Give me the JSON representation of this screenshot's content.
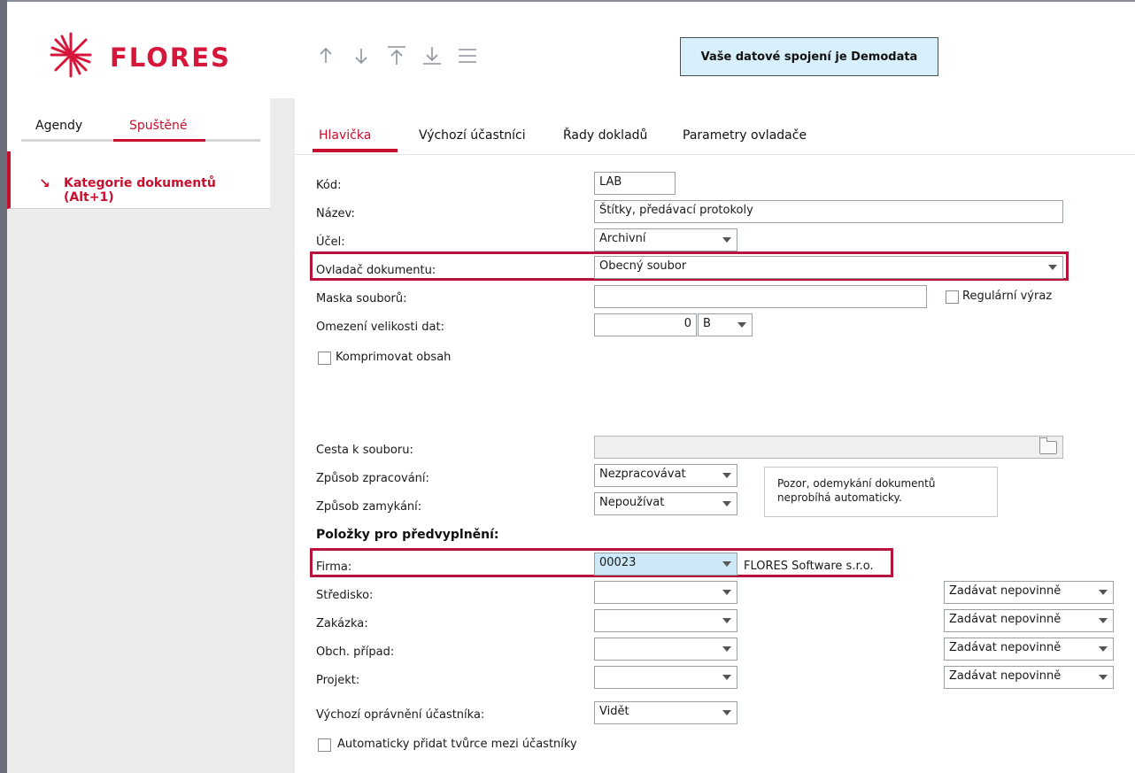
{
  "header": {
    "logo_text": "FLORES",
    "nav_icons": [
      "arrow-up-icon",
      "arrow-down-icon",
      "first-record-icon",
      "last-record-icon",
      "menu-icon"
    ],
    "connection_message": "Vaše datové spojení je Demodata"
  },
  "sidebar": {
    "tabs": [
      "Agendy",
      "Spuštěné"
    ],
    "active_tab": "Spuštěné",
    "items": [
      {
        "label": "Kategorie dokumentů (Alt+1)"
      }
    ]
  },
  "main": {
    "tabs": [
      {
        "label": "Hlavička"
      },
      {
        "label": "Výchozí účastníci"
      },
      {
        "label": "Řady dokladů"
      },
      {
        "label": "Parametry ovladače"
      }
    ],
    "active_tab": "Hlavička"
  },
  "form": {
    "kod": {
      "label": "Kód:",
      "value": "LAB"
    },
    "nazev": {
      "label": "Název:",
      "value": "Štítky, předávací protokoly"
    },
    "ucel": {
      "label": "Účel:",
      "value": "Archivní"
    },
    "ovladac": {
      "label": "Ovladač dokumentu:",
      "value": "Obecný soubor"
    },
    "maska": {
      "label": "Maska souborů:",
      "value": ""
    },
    "regularni": {
      "label": "Regulární výraz",
      "checked": false
    },
    "omezeni": {
      "label": "Omezení velikosti dat:",
      "value": "0",
      "unit": "B"
    },
    "komprimovat": {
      "label": "Komprimovat obsah",
      "checked": false
    },
    "cesta": {
      "label": "Cesta k souboru:",
      "value": ""
    },
    "zpracovani": {
      "label": "Způsob zpracování:",
      "value": "Nezpracovávat"
    },
    "zamykani": {
      "label": "Způsob zamykání:",
      "value": "Nepoužívat"
    },
    "note": "Pozor, odemykání dokumentů neprobíhá automaticky.",
    "section_title": "Položky pro předvyplnění:",
    "firma": {
      "label": "Firma:",
      "value": "00023",
      "name": "FLORES Software s.r.o."
    },
    "stredisko": {
      "label": "Středisko:",
      "value": "",
      "mode": "Zadávat nepovinně"
    },
    "zakazka": {
      "label": "Zakázka:",
      "value": "",
      "mode": "Zadávat nepovinně"
    },
    "obch_pripad": {
      "label": "Obch. případ:",
      "value": "",
      "mode": "Zadávat nepovinně"
    },
    "projekt": {
      "label": "Projekt:",
      "value": "",
      "mode": "Zadávat nepovinně"
    },
    "opravneni": {
      "label": "Výchozí oprávnění účastníka:",
      "value": "Vidět"
    },
    "auto_pridat": {
      "label": "Automaticky přidat tvůrce mezi účastníky",
      "checked": false
    }
  },
  "colors": {
    "accent": "#c8102e",
    "banner": "#d7f0fb",
    "highlight_frame": "#b8133a"
  }
}
